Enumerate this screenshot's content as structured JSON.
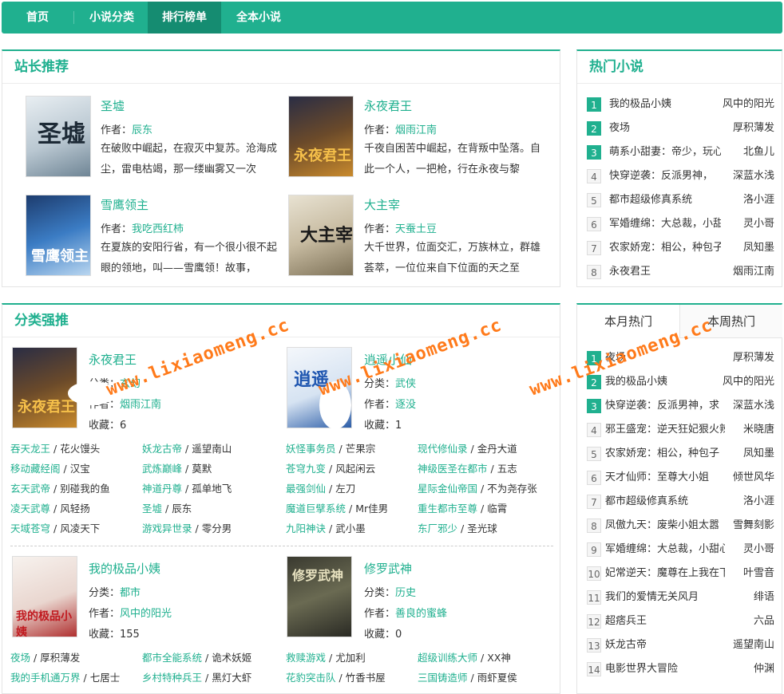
{
  "nav": {
    "items": [
      "首页",
      "小说分类",
      "排行榜单",
      "全本小说"
    ],
    "active": 2
  },
  "recommend": {
    "title": "站长推荐",
    "books": [
      {
        "title": "圣墟",
        "author_label": "作者：",
        "author": "辰东",
        "desc": "在破败中崛起，在寂灭中复苏。沧海成尘，雷电枯竭，那一缕幽雾又一次",
        "cover_text": "圣墟"
      },
      {
        "title": "永夜君王",
        "author_label": "作者：",
        "author": "烟雨江南",
        "desc": "千夜自困苦中崛起，在背叛中坠落。自此一个人，一把枪，行在永夜与黎",
        "cover_text": "永夜君王"
      },
      {
        "title": "雪鹰领主",
        "author_label": "作者：",
        "author": "我吃西红柿",
        "desc": "在夏族的安阳行省，有一个很小很不起眼的领地，叫——雪鹰领！故事，",
        "cover_text": "雪鹰领主"
      },
      {
        "title": "大主宰",
        "author_label": "作者：",
        "author": "天蚕土豆",
        "desc": "大千世界，位面交汇，万族林立，群雄荟萃，一位位来自下位面的天之至",
        "cover_text": "大主宰"
      }
    ]
  },
  "hot": {
    "title": "热门小说",
    "items": [
      {
        "n": "1",
        "name": "我的极品小姨",
        "author": "风中的阳光"
      },
      {
        "n": "2",
        "name": "夜场",
        "author": "厚积薄发"
      },
      {
        "n": "3",
        "name": "萌系小甜妻：帝少，玩心",
        "author": "北鱼儿"
      },
      {
        "n": "4",
        "name": "快穿逆袭：反派男神，",
        "author": "深蓝水浅"
      },
      {
        "n": "5",
        "name": "都市超级修真系统",
        "author": "洛小涯"
      },
      {
        "n": "6",
        "name": "军婚缠绵：大总裁，小甜",
        "author": "灵小哥"
      },
      {
        "n": "7",
        "name": "农家娇宠：相公，种包子",
        "author": "凤知墨"
      },
      {
        "n": "8",
        "name": "永夜君王",
        "author": "烟雨江南"
      }
    ]
  },
  "category": {
    "title": "分类强推",
    "blocks": [
      {
        "title": "永夜君王",
        "cat_label": "分类：",
        "cat": "玄幻",
        "author_label": "作者：",
        "author": "烟雨江南",
        "fav_label": "收藏：",
        "fav": "6",
        "cover_text": "永夜君王",
        "list": [
          [
            "吞天龙王",
            "花火馒头"
          ],
          [
            "移动藏经阁",
            "汉宝"
          ],
          [
            "玄天武帝",
            "别碰我的鱼"
          ],
          [
            "凌天武尊",
            "风轻扬"
          ],
          [
            "天域苍穹",
            "风凌天下"
          ],
          [
            "妖龙古帝",
            "遥望南山"
          ],
          [
            "武炼巅峰",
            "莫默"
          ],
          [
            "神道丹尊",
            "孤单地飞"
          ],
          [
            "圣墟",
            "辰东"
          ],
          [
            "游戏异世录",
            "零分男"
          ]
        ]
      },
      {
        "title": "逍遥小仙",
        "cat_label": "分类：",
        "cat": "武侠",
        "author_label": "作者：",
        "author": "逐没",
        "fav_label": "收藏：",
        "fav": "1",
        "cover_text": "逍遥",
        "list": [
          [
            "妖怪事务员",
            "芒果宗"
          ],
          [
            "苍穹九变",
            "风起闲云"
          ],
          [
            "最强剑仙",
            "左刀"
          ],
          [
            "魔道巨擘系统",
            "Mr佳男"
          ],
          [
            "九阳神诀",
            "武小墨"
          ],
          [
            "现代修仙录",
            "金丹大道"
          ],
          [
            "神级医圣在都市",
            "五志"
          ],
          [
            "星际金仙帝国",
            "不为尧存张"
          ],
          [
            "重生都市至尊",
            "临霄"
          ],
          [
            "东厂邪少",
            "圣光球"
          ]
        ]
      },
      {
        "title": "我的极品小姨",
        "cat_label": "分类：",
        "cat": "都市",
        "author_label": "作者：",
        "author": "风中的阳光",
        "fav_label": "收藏：",
        "fav": "155",
        "cover_text": "我的极品小姨",
        "list": [
          [
            "夜场",
            "厚积薄发"
          ],
          [
            "我的手机通万界",
            "七居士"
          ],
          [
            "都市全能系统",
            "诡术妖姬"
          ],
          [
            "乡村特种兵王",
            "黑灯大虾"
          ]
        ]
      },
      {
        "title": "修罗武神",
        "cat_label": "分类：",
        "cat": "历史",
        "author_label": "作者：",
        "author": "善良的蜜蜂",
        "fav_label": "收藏：",
        "fav": "0",
        "cover_text": "修罗武神",
        "list": [
          [
            "救赎游戏",
            "尤加利"
          ],
          [
            "花豹突击队",
            "竹香书屋"
          ],
          [
            "超级训练大师",
            "XX神"
          ],
          [
            "三国铸造师",
            "雨虾夏侯"
          ]
        ]
      }
    ]
  },
  "ranking": {
    "tabs": [
      "本月热门",
      "本周热门"
    ],
    "items": [
      {
        "n": "1",
        "name": "夜场",
        "author": "厚积薄发"
      },
      {
        "n": "2",
        "name": "我的极品小姨",
        "author": "风中的阳光"
      },
      {
        "n": "3",
        "name": "快穿逆袭：反派男神，求",
        "author": "深蓝水浅"
      },
      {
        "n": "4",
        "name": "邪王盛宠：逆天狂妃狠火辣",
        "author": "米晓唐"
      },
      {
        "n": "5",
        "name": "农家娇宠：相公，种包子",
        "author": "凤知墨"
      },
      {
        "n": "6",
        "name": "天才仙师：至尊大小姐",
        "author": "倾世风华"
      },
      {
        "n": "7",
        "name": "都市超级修真系统",
        "author": "洛小涯"
      },
      {
        "n": "8",
        "name": "凤傲九天：废柴小姐太嚣",
        "author": "雪舞刻影"
      },
      {
        "n": "9",
        "name": "军婚缠绵：大总裁，小甜心",
        "author": "灵小哥"
      },
      {
        "n": "10",
        "name": "妃常逆天：魔尊在上我在下",
        "author": "叶雪音"
      },
      {
        "n": "11",
        "name": "我们的爱情无关风月",
        "author": "绯语"
      },
      {
        "n": "12",
        "name": "超痞兵王",
        "author": "六品"
      },
      {
        "n": "13",
        "name": "妖龙古帝",
        "author": "遥望南山"
      },
      {
        "n": "14",
        "name": "电影世界大冒险",
        "author": "仲渊"
      }
    ]
  },
  "watermark": "www.lixiaomeng.cc"
}
